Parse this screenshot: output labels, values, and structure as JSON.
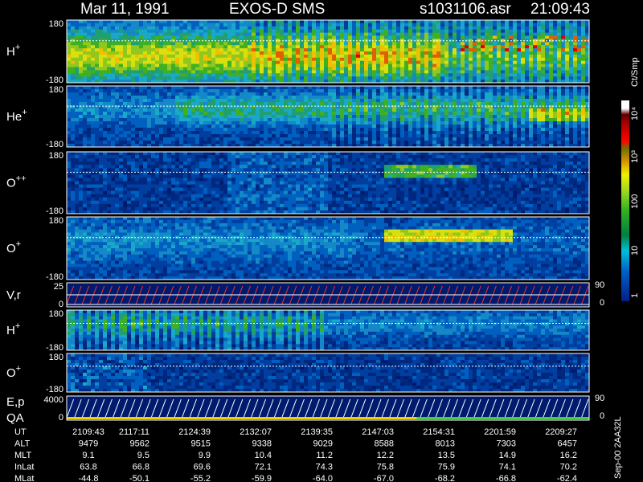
{
  "header": {
    "date": "Mar 11, 1991",
    "instrument": "EXOS-D SMS",
    "file": "s1031106.asr",
    "time": "21:09:43"
  },
  "colorbar": {
    "unit": "Ct/Smp",
    "ticks": [
      "10⁴",
      "10³",
      "100",
      "10",
      "1"
    ]
  },
  "side_label": "Sep-00  2AA32L",
  "colors": {
    "background": "#000000",
    "low": "#001a6e",
    "trace": "#ff3322"
  },
  "chart_data": {
    "type": "heatmap",
    "title": "Mar 11, 1991   EXOS-D SMS",
    "panels": [
      {
        "id": "h-plus-1",
        "label_main": "H",
        "label_sup": "+",
        "y_top": "180",
        "y_bottom": "-180",
        "intensity": "high"
      },
      {
        "id": "he-plus",
        "label_main": "He",
        "label_sup": "+",
        "y_top": "180",
        "y_bottom": "-180",
        "intensity": "medium"
      },
      {
        "id": "o-plusplus",
        "label_main": "O",
        "label_sup": "++",
        "y_top": "180",
        "y_bottom": "-180",
        "intensity": "low"
      },
      {
        "id": "o-plus-1",
        "label_main": "O",
        "label_sup": "+",
        "y_top": "180",
        "y_bottom": "-180",
        "intensity": "medium"
      },
      {
        "id": "vr",
        "label_main": "V,r",
        "label_sup": "",
        "y_top": "25",
        "y_bottom": "0",
        "right_top": "90",
        "right_bottom": "0",
        "kind": "trace"
      },
      {
        "id": "h-plus-2",
        "label_main": "H",
        "label_sup": "+",
        "y_top": "180",
        "y_bottom": "-180",
        "intensity": "medium"
      },
      {
        "id": "o-plus-2",
        "label_main": "O",
        "label_sup": "+",
        "y_top": "180",
        "y_bottom": "-180",
        "intensity": "low"
      },
      {
        "id": "ep-qa",
        "label_main": "E,p",
        "label_line2": "QA",
        "y_top": "4000",
        "y_bottom": "0",
        "right_top": "90",
        "right_bottom": "0",
        "kind": "trace"
      }
    ],
    "axis_rows": [
      {
        "name": "UT",
        "values": [
          "2109:43",
          "2117:11",
          "2124:39",
          "2132:07",
          "2139:35",
          "2147:03",
          "2154:31",
          "2201:59",
          "2209:27"
        ]
      },
      {
        "name": "ALT",
        "values": [
          "9479",
          "9562",
          "9515",
          "9338",
          "9029",
          "8588",
          "8013",
          "7303",
          "6457"
        ]
      },
      {
        "name": "MLT",
        "values": [
          "9.1",
          "9.5",
          "9.9",
          "10.4",
          "11.2",
          "12.2",
          "13.5",
          "14.9",
          "16.2"
        ]
      },
      {
        "name": "InLat",
        "values": [
          "63.8",
          "66.8",
          "69.6",
          "72.1",
          "74.3",
          "75.8",
          "75.9",
          "74.1",
          "70.2"
        ]
      },
      {
        "name": "MLat",
        "values": [
          "-44.8",
          "-50.1",
          "-55.2",
          "-59.9",
          "-64.0",
          "-67.0",
          "-68.2",
          "-66.8",
          "-62.4"
        ]
      }
    ]
  }
}
